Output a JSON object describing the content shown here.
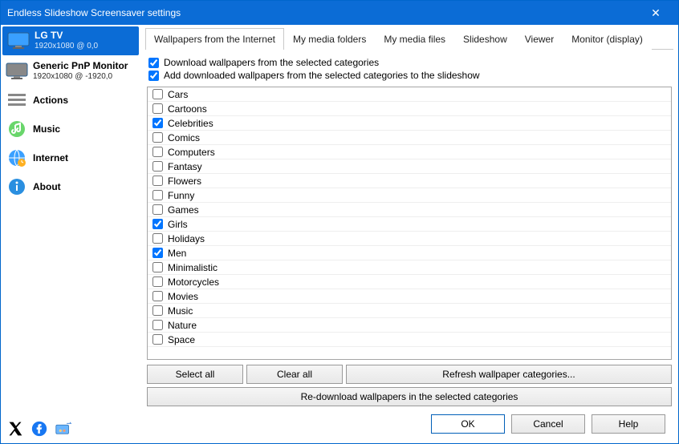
{
  "window": {
    "title": "Endless Slideshow Screensaver settings"
  },
  "sidebar": {
    "items": [
      {
        "label": "LG TV",
        "sub": "1920x1080 @ 0,0",
        "selected": true,
        "iconColor": "#3aa0ff"
      },
      {
        "label": "Generic PnP Monitor",
        "sub": "1920x1080 @ -1920,0",
        "iconColor": "#888"
      },
      {
        "label": "Actions"
      },
      {
        "label": "Music"
      },
      {
        "label": "Internet"
      },
      {
        "label": "About"
      }
    ]
  },
  "tabs": [
    {
      "label": "Wallpapers from the Internet",
      "active": true
    },
    {
      "label": "My media folders"
    },
    {
      "label": "My media files"
    },
    {
      "label": "Slideshow"
    },
    {
      "label": "Viewer"
    },
    {
      "label": "Monitor (display)"
    }
  ],
  "options": {
    "download": {
      "label": "Download wallpapers from the selected categories",
      "checked": true
    },
    "addToSlideshow": {
      "label": "Add downloaded wallpapers from the selected categories to the slideshow",
      "checked": true
    }
  },
  "categories": [
    {
      "label": "Cars",
      "checked": false
    },
    {
      "label": "Cartoons",
      "checked": false
    },
    {
      "label": "Celebrities",
      "checked": true
    },
    {
      "label": "Comics",
      "checked": false
    },
    {
      "label": "Computers",
      "checked": false
    },
    {
      "label": "Fantasy",
      "checked": false
    },
    {
      "label": "Flowers",
      "checked": false
    },
    {
      "label": "Funny",
      "checked": false
    },
    {
      "label": "Games",
      "checked": false
    },
    {
      "label": "Girls",
      "checked": true
    },
    {
      "label": "Holidays",
      "checked": false
    },
    {
      "label": "Men",
      "checked": true
    },
    {
      "label": "Minimalistic",
      "checked": false
    },
    {
      "label": "Motorcycles",
      "checked": false
    },
    {
      "label": "Movies",
      "checked": false
    },
    {
      "label": "Music",
      "checked": false
    },
    {
      "label": "Nature",
      "checked": false
    },
    {
      "label": "Space",
      "checked": false
    }
  ],
  "buttons": {
    "selectAll": "Select all",
    "clearAll": "Clear all",
    "refresh": "Refresh wallpaper categories...",
    "redownload": "Re-download wallpapers in the selected categories",
    "ok": "OK",
    "cancel": "Cancel",
    "help": "Help"
  }
}
